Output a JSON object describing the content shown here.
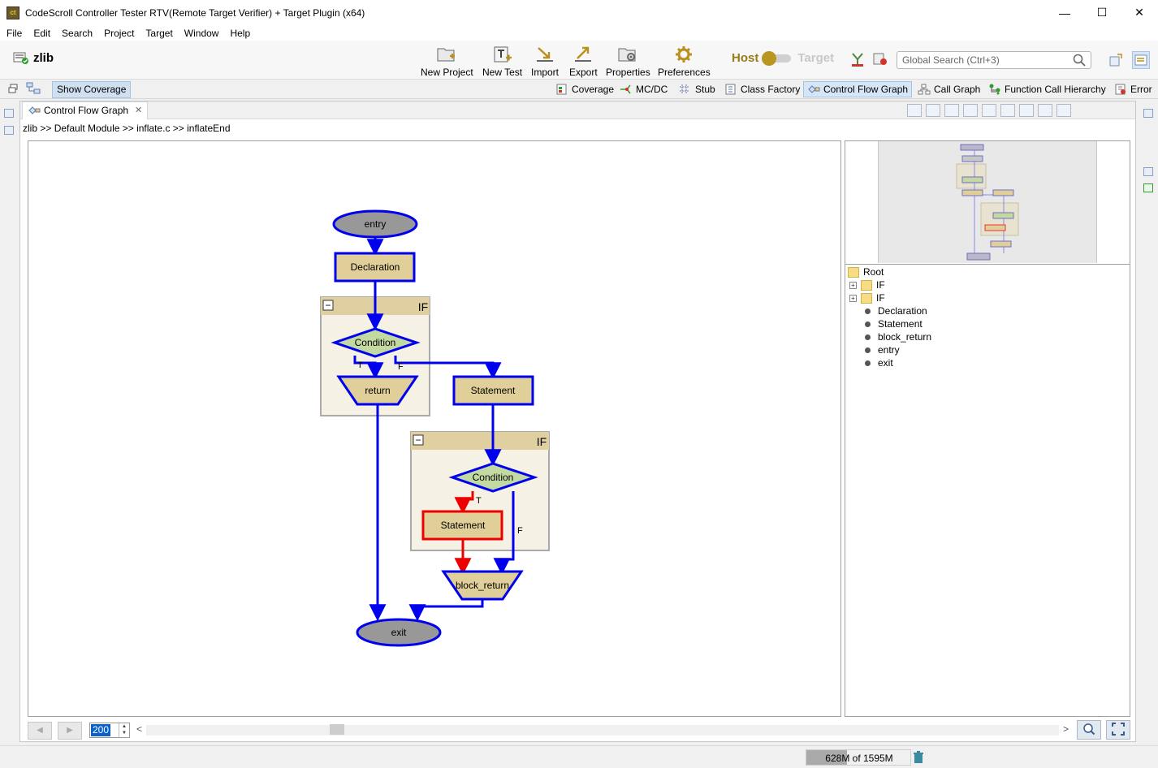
{
  "window": {
    "title": "CodeScroll Controller Tester RTV(Remote Target Verifier) + Target Plugin (x64)",
    "app_icon_text": "ct",
    "minimize": "—",
    "maximize": "☐",
    "close": "✕"
  },
  "menu": [
    "File",
    "Edit",
    "Search",
    "Project",
    "Target",
    "Window",
    "Help"
  ],
  "project": {
    "name": "zlib"
  },
  "main_toolbar": {
    "new_project": "New Project",
    "new_test": "New Test",
    "import": "Import",
    "export": "Export",
    "properties": "Properties",
    "preferences": "Preferences",
    "host": "Host",
    "target": "Target",
    "search_placeholder": "Global Search (Ctrl+3)"
  },
  "view_toolbar": {
    "show_coverage": "Show Coverage",
    "coverage": "Coverage",
    "mcdc": "MC/DC",
    "stub": "Stub",
    "class_factory": "Class Factory",
    "control_flow_graph": "Control Flow Graph",
    "call_graph": "Call Graph",
    "function_call_hierarchy": "Function Call Hierarchy",
    "error": "Error"
  },
  "editor": {
    "tab_label": "Control Flow Graph",
    "tab_close": "✕",
    "breadcrumb": "zlib >> Default Module >> inflate.c >> inflateEnd"
  },
  "graph": {
    "if_label": "IF",
    "collapse_symbol": "−",
    "nodes": {
      "entry": "entry",
      "declaration": "Declaration",
      "condition1": "Condition",
      "return": "return",
      "statement1": "Statement",
      "condition2": "Condition",
      "statement2": "Statement",
      "block_return": "block_return",
      "exit": "exit"
    },
    "edge_labels": {
      "true": "T",
      "false": "F"
    },
    "colors": {
      "edge": "#0000ee",
      "covered_edge": "#ee0000",
      "node_fill": "#e0cf98",
      "condition_fill": "#c3d9a2",
      "terminal_fill": "#989898",
      "if_header": "#e0cfa0",
      "if_body": "#f5f1e5"
    }
  },
  "outline": {
    "root": "Root",
    "folders": [
      "IF",
      "IF"
    ],
    "leaves": [
      "Declaration",
      "Statement",
      "block_return",
      "entry",
      "exit"
    ],
    "expand_symbol": "+"
  },
  "bottom": {
    "zoom": "200",
    "prev": "◀",
    "next": "▶",
    "spin_up": "▲",
    "spin_down": "▼",
    "scroll_left": "<",
    "scroll_right": ">"
  },
  "status": {
    "memory": "628M of 1595M",
    "memory_used_fraction": 0.39
  }
}
